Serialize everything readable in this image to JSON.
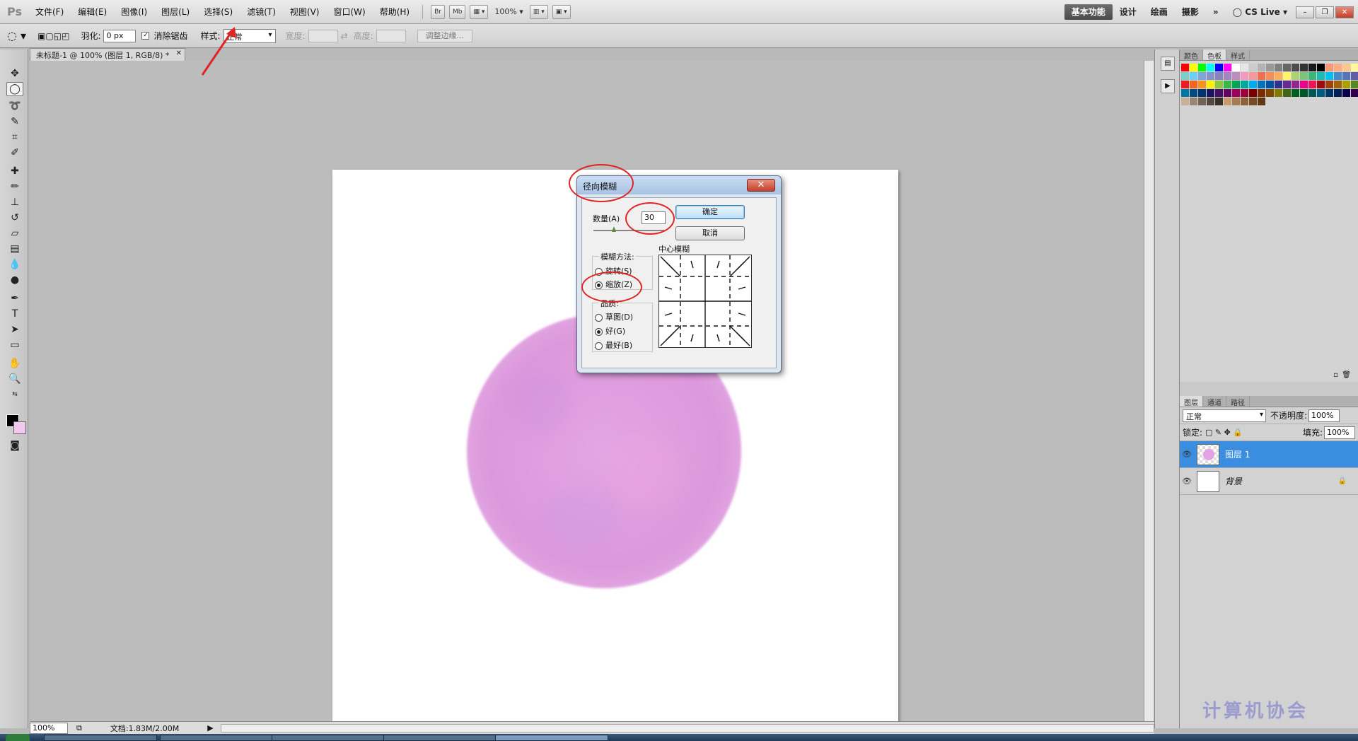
{
  "menubar": {
    "logo": "Ps",
    "items": [
      "文件(F)",
      "编辑(E)",
      "图像(I)",
      "图层(L)",
      "选择(S)",
      "滤镜(T)",
      "视图(V)",
      "窗口(W)",
      "帮助(H)"
    ],
    "bridge": "Br",
    "minibridge": "Mb",
    "zoom": "100%",
    "workspaces": [
      "基本功能",
      "设计",
      "绘画",
      "摄影"
    ],
    "more": "»",
    "cslive": "CS Live"
  },
  "options": {
    "feather_label": "羽化:",
    "feather_value": "0 px",
    "antialias_label": "消除锯齿",
    "style_label": "样式:",
    "style_value": "正常",
    "width_label": "宽度:",
    "height_label": "高度:",
    "refine_edge": "调整边缘..."
  },
  "document": {
    "tab_title": "未标题-1 @ 100% (图层 1, RGB/8) *",
    "zoom": "100%",
    "doc_size": "文档:1.83M/2.00M"
  },
  "dialog": {
    "title": "径向模糊",
    "amount_label": "数量(A)",
    "amount_value": "30",
    "ok": "确定",
    "cancel": "取消",
    "method_label": "模糊方法:",
    "method_spin": "旋转(S)",
    "method_zoom": "缩放(Z)",
    "quality_label": "品质:",
    "quality_draft": "草图(D)",
    "quality_good": "好(G)",
    "quality_best": "最好(B)",
    "center_label": "中心模糊"
  },
  "panels": {
    "swatch_tabs": [
      "颜色",
      "色板",
      "样式"
    ],
    "layer_tabs": [
      "图层",
      "通道",
      "路径"
    ],
    "blend_mode": "正常",
    "opacity_label": "不透明度:",
    "opacity_value": "100%",
    "lock_label": "锁定:",
    "fill_label": "填充:",
    "fill_value": "100%",
    "layers": [
      "图层 1",
      "背景"
    ]
  },
  "watermark": "计算机协会",
  "colors": {
    "accent": "#3a8ddf",
    "annotation": "#e02424",
    "circle": "#dc98dc"
  }
}
